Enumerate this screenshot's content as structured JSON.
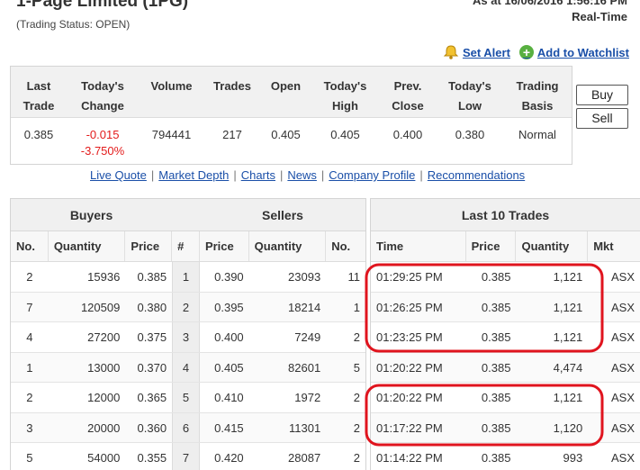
{
  "header": {
    "title": "1-Page Limited (1PG)",
    "status": "(Trading Status: OPEN)",
    "as_at": "As at 16/06/2016 1:56:16 PM",
    "realtime": "Real-Time"
  },
  "actions": {
    "set_alert": "Set Alert",
    "add_watchlist": "Add to Watchlist"
  },
  "quote": {
    "headers": [
      "Last\nTrade",
      "Today's\nChange",
      "Volume",
      "Trades",
      "Open",
      "Today's\nHigh",
      "Prev.\nClose",
      "Today's\nLow",
      "Trading\nBasis"
    ],
    "last_trade": "0.385",
    "change_abs": "-0.015",
    "change_pct": "-3.750%",
    "volume": "794441",
    "trades": "217",
    "open": "0.405",
    "high": "0.405",
    "prev_close": "0.400",
    "low": "0.380",
    "basis": "Normal",
    "buy_label": "Buy",
    "sell_label": "Sell"
  },
  "nav": {
    "live_quote": "Live Quote",
    "market_depth": "Market Depth",
    "charts": "Charts",
    "news": "News",
    "company_profile": "Company Profile",
    "recommendations": "Recommendations"
  },
  "depth": {
    "buyers_title": "Buyers",
    "sellers_title": "Sellers",
    "col_no": "No.",
    "col_qty": "Quantity",
    "col_price": "Price",
    "col_hash": "#",
    "rows": [
      {
        "b_no": "2",
        "b_qty": "15936",
        "b_price": "0.385",
        "idx": "1",
        "s_price": "0.390",
        "s_qty": "23093",
        "s_no": "11"
      },
      {
        "b_no": "7",
        "b_qty": "120509",
        "b_price": "0.380",
        "idx": "2",
        "s_price": "0.395",
        "s_qty": "18214",
        "s_no": "1"
      },
      {
        "b_no": "4",
        "b_qty": "27200",
        "b_price": "0.375",
        "idx": "3",
        "s_price": "0.400",
        "s_qty": "7249",
        "s_no": "2"
      },
      {
        "b_no": "1",
        "b_qty": "13000",
        "b_price": "0.370",
        "idx": "4",
        "s_price": "0.405",
        "s_qty": "82601",
        "s_no": "5"
      },
      {
        "b_no": "2",
        "b_qty": "12000",
        "b_price": "0.365",
        "idx": "5",
        "s_price": "0.410",
        "s_qty": "1972",
        "s_no": "2"
      },
      {
        "b_no": "3",
        "b_qty": "20000",
        "b_price": "0.360",
        "idx": "6",
        "s_price": "0.415",
        "s_qty": "11301",
        "s_no": "2"
      },
      {
        "b_no": "5",
        "b_qty": "54000",
        "b_price": "0.355",
        "idx": "7",
        "s_price": "0.420",
        "s_qty": "28087",
        "s_no": "2"
      }
    ]
  },
  "trades": {
    "title": "Last 10 Trades",
    "col_time": "Time",
    "col_price": "Price",
    "col_qty": "Quantity",
    "col_mkt": "Mkt",
    "rows": [
      {
        "time": "01:29:25 PM",
        "price": "0.385",
        "qty": "1,121",
        "mkt": "ASX"
      },
      {
        "time": "01:26:25 PM",
        "price": "0.385",
        "qty": "1,121",
        "mkt": "ASX"
      },
      {
        "time": "01:23:25 PM",
        "price": "0.385",
        "qty": "1,121",
        "mkt": "ASX"
      },
      {
        "time": "01:20:22 PM",
        "price": "0.385",
        "qty": "4,474",
        "mkt": "ASX"
      },
      {
        "time": "01:20:22 PM",
        "price": "0.385",
        "qty": "1,121",
        "mkt": "ASX"
      },
      {
        "time": "01:17:22 PM",
        "price": "0.385",
        "qty": "1,120",
        "mkt": "ASX"
      },
      {
        "time": "01:14:22 PM",
        "price": "0.385",
        "qty": "993",
        "mkt": "ASX"
      }
    ]
  },
  "highlight_color": "#e0141e",
  "link_color": "#1a4fa8",
  "negative_color": "#e31b1b"
}
